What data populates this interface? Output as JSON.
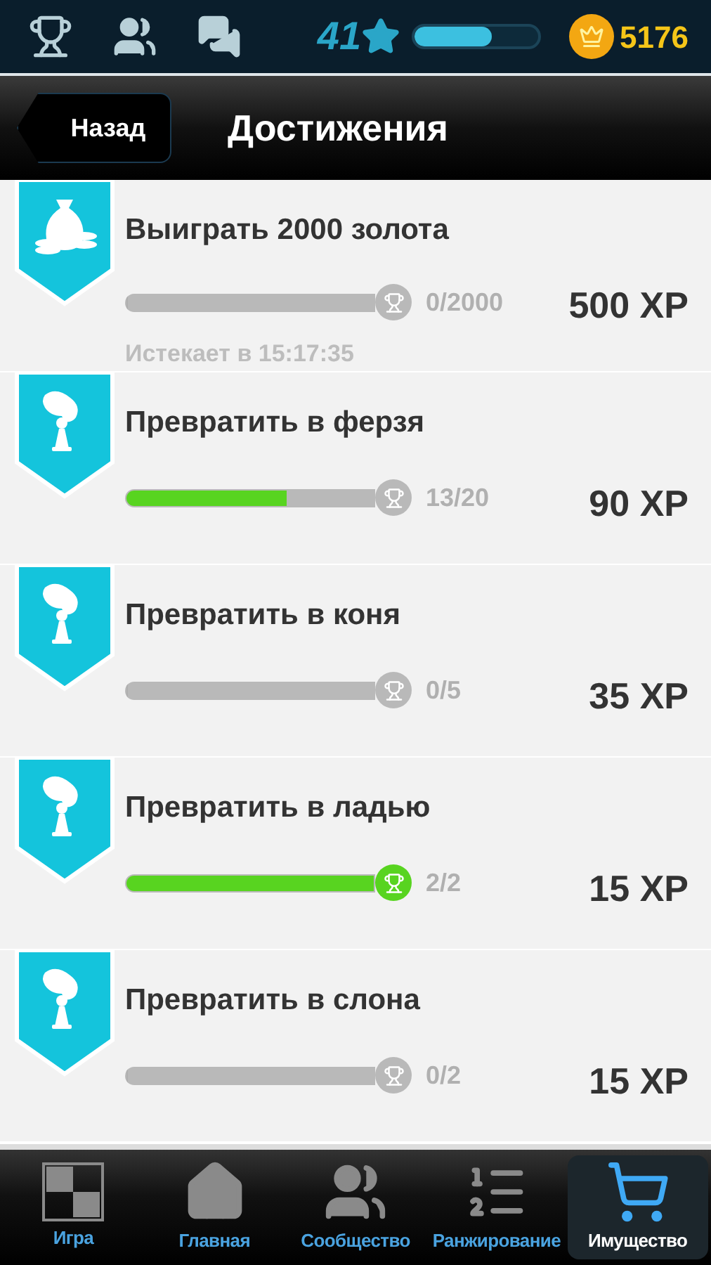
{
  "top_bar": {
    "level_number": "41",
    "xp": {
      "level": 0.62
    },
    "coins": "5176"
  },
  "header": {
    "back_button": "Назад",
    "title": "Достижения"
  },
  "achievements": [
    {
      "kind": "gold",
      "title": "Выиграть 2000 золота",
      "progress": {
        "level": 0
      },
      "count": "0/2000",
      "expires": "Истекает в 15:17:35",
      "reward": "500 XP",
      "completed": false
    },
    {
      "kind": "promote",
      "title": "Превратить в ферзя",
      "progress": {
        "level": 0.65
      },
      "count": "13/20",
      "reward": "90 XP",
      "completed": false
    },
    {
      "kind": "promote",
      "title": "Превратить в коня",
      "progress": {
        "level": 0
      },
      "count": "0/5",
      "reward": "35 XP",
      "completed": false
    },
    {
      "kind": "promote",
      "title": "Превратить в ладью",
      "progress": {
        "level": 1
      },
      "count": "2/2",
      "reward": "15 XP",
      "completed": true
    },
    {
      "kind": "promote",
      "title": "Превратить в слона",
      "progress": {
        "level": 0
      },
      "count": "0/2",
      "reward": "15 XP",
      "completed": false
    }
  ],
  "bottom_nav": [
    {
      "kind": "game",
      "label": "Игра",
      "selected": false
    },
    {
      "kind": "home",
      "label": "Главная",
      "selected": false
    },
    {
      "kind": "community",
      "label": "Сообщество",
      "selected": false
    },
    {
      "kind": "ranking",
      "label": "Ранжирование",
      "selected": false
    },
    {
      "kind": "shop",
      "label": "Имущество",
      "selected": true
    }
  ]
}
